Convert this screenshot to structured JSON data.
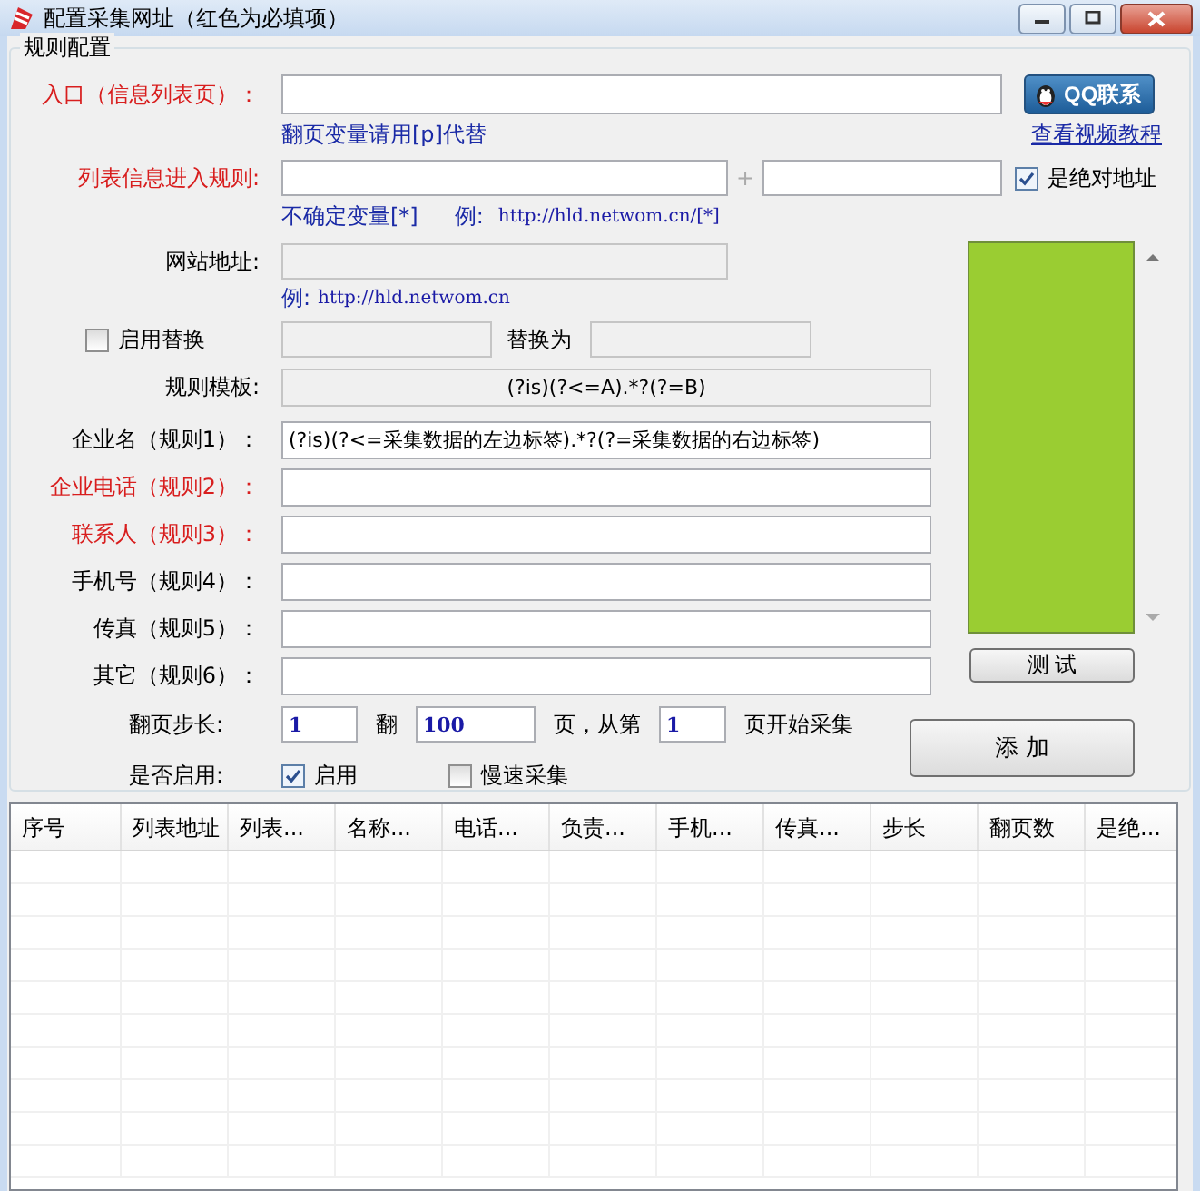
{
  "window": {
    "title": "配置采集网址（红色为必填项）"
  },
  "group": {
    "title": "规则配置"
  },
  "entry": {
    "label": "入口（信息列表页）：",
    "required": true,
    "hint": "翻页变量请用[p]代替"
  },
  "qq_button": {
    "label": "QQ联系"
  },
  "tutorial_link": {
    "label": "查看视频教程"
  },
  "list_rule": {
    "label": "列表信息进入规则:",
    "required": true,
    "plus": "+",
    "hint": "不确定变量[*]",
    "example_label": "例:",
    "example": "http://hld.netwom.cn/[*]",
    "absolute": {
      "label": "是绝对地址",
      "checked": true
    }
  },
  "site": {
    "label": "网站地址:",
    "disabled": true,
    "example_label": "例:",
    "example": "http://hld.netwom.cn"
  },
  "replace": {
    "label": "启用替换",
    "checked": false,
    "disabled": true,
    "to_label": "替换为"
  },
  "template": {
    "label": "规则模板:",
    "value": "(?is)(?<=A).*?(?=B)"
  },
  "rules": [
    {
      "label": "企业名（规则1）：",
      "required": false,
      "value": "(?is)(?<=采集数据的左边标签).*?(?=采集数据的右边标签)"
    },
    {
      "label": "企业电话（规则2）：",
      "required": true
    },
    {
      "label": "联系人（规则3）：",
      "required": true
    },
    {
      "label": "手机号（规则4）：",
      "required": false
    },
    {
      "label": "传真（规则5）：",
      "required": false
    },
    {
      "label": "其它（规则6）：",
      "required": false
    }
  ],
  "paging": {
    "label": "翻页步长:",
    "step": "1",
    "pages_label": "翻",
    "pages": "100",
    "from_label": "页，从第",
    "start": "1",
    "suffix": "页开始采集"
  },
  "enable": {
    "label": "是否启用:",
    "options": [
      {
        "label": "启用",
        "checked": true
      },
      {
        "label": "慢速采集",
        "checked": false
      }
    ]
  },
  "test_button": {
    "label": "测 试"
  },
  "add_button": {
    "label": "添 加"
  },
  "table": {
    "columns": [
      "序号",
      "列表地址",
      "列表...",
      "名称...",
      "电话...",
      "负责...",
      "手机...",
      "传真...",
      "步长",
      "翻页数",
      "是绝..."
    ]
  }
}
